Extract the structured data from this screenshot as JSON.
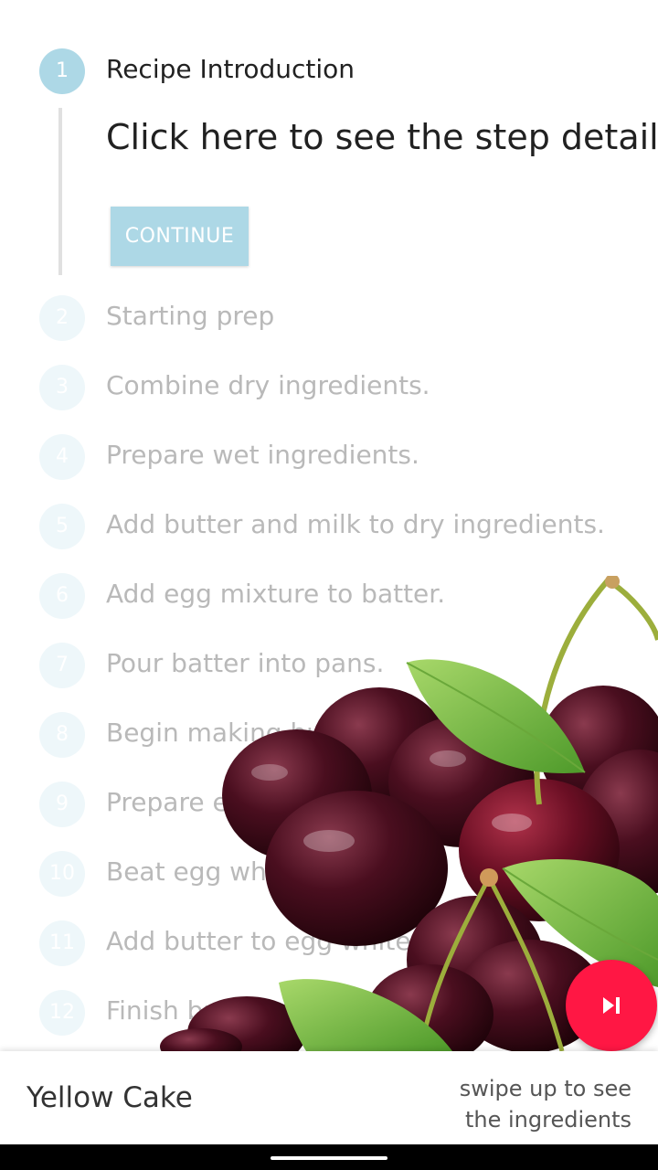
{
  "stepper": {
    "active_step": {
      "number": "1",
      "title": "Recipe Introduction",
      "detail": "Click here to see the step detail",
      "continue_label": "CONTINUE"
    },
    "steps": [
      {
        "number": "2",
        "title": "Starting prep"
      },
      {
        "number": "3",
        "title": "Combine dry ingredients."
      },
      {
        "number": "4",
        "title": "Prepare wet ingredients."
      },
      {
        "number": "5",
        "title": "Add butter and milk to dry ingredients."
      },
      {
        "number": "6",
        "title": "Add egg mixture to batter."
      },
      {
        "number": "7",
        "title": "Pour batter into pans."
      },
      {
        "number": "8",
        "title": "Begin making buttercream."
      },
      {
        "number": "9",
        "title": "Prepare egg whites."
      },
      {
        "number": "10",
        "title": "Beat egg whites to peaks."
      },
      {
        "number": "11",
        "title": "Add butter to egg white mixture."
      },
      {
        "number": "12",
        "title": "Finish buttercream icing."
      }
    ]
  },
  "fab": {
    "icon": "skip-next-icon",
    "color": "#ff1744"
  },
  "bottom_bar": {
    "recipe_title": "Yellow Cake",
    "swipe_hint_line1": "swipe up to see",
    "swipe_hint_line2": "the ingredients"
  },
  "colors": {
    "accent": "#add8e6",
    "fab": "#ff1744",
    "inactive_text": "#b9b9b9"
  }
}
